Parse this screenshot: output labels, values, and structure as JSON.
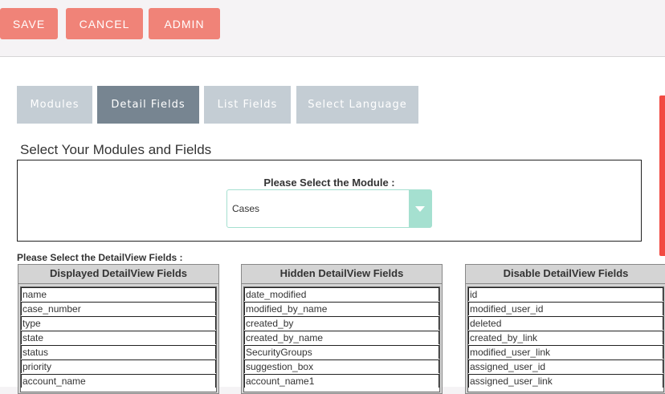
{
  "toolbar": {
    "save_label": "SAVE",
    "cancel_label": "CANCEL",
    "admin_label": "ADMIN"
  },
  "tabs": [
    {
      "label": "Modules"
    },
    {
      "label": "Detail Fields"
    },
    {
      "label": "List Fields"
    },
    {
      "label": "Select Language"
    }
  ],
  "active_tab": "Detail Fields",
  "section": {
    "title": "Select Your Modules and Fields",
    "module_label": "Please Select the Module :",
    "module_value": "Cases",
    "fields_label": "Please Select the DetailView Fields :"
  },
  "columns": [
    {
      "title": "Displayed DetailView Fields",
      "items": [
        "name",
        "case_number",
        "type",
        "state",
        "status",
        "priority",
        "account_name"
      ]
    },
    {
      "title": "Hidden DetailView Fields",
      "items": [
        "date_modified",
        "modified_by_name",
        "created_by",
        "created_by_name",
        "SecurityGroups",
        "suggestion_box",
        "account_name1"
      ]
    },
    {
      "title": "Disable DetailView Fields",
      "items": [
        "id",
        "modified_user_id",
        "deleted",
        "created_by_link",
        "modified_user_link",
        "assigned_user_id",
        "assigned_user_link"
      ]
    }
  ],
  "colors": {
    "button": "#f08378",
    "tab": "#c4cdd4",
    "tab_active": "#778591",
    "select_accent": "#a5e0d0",
    "scroll_accent": "#f24a42"
  }
}
